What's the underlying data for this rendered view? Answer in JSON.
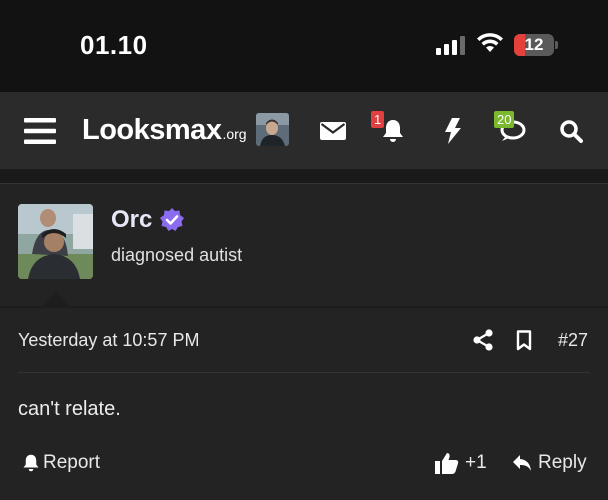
{
  "status_bar": {
    "time": "01.10",
    "battery_level": "12",
    "battery_color": "#e5413a",
    "icons": [
      "signal-icon",
      "wifi-icon",
      "battery-icon"
    ]
  },
  "navbar": {
    "logo_main": "Looksmax",
    "logo_tld": ".org",
    "notifications_count": "1",
    "conversations_count": "20",
    "icons": [
      "menu-icon",
      "avatar",
      "envelope-icon",
      "bell-icon",
      "bolt-icon",
      "chat-icon",
      "search-icon"
    ],
    "badge_colors": {
      "alerts": "#e04040",
      "conversations": "#7ab82d"
    }
  },
  "post": {
    "author": {
      "username": "Orc",
      "title": "diagnosed autist",
      "verified_color": "#8b6cf0"
    },
    "timestamp": "Yesterday at 10:57 PM",
    "post_number": "#27",
    "message": "can't relate.",
    "actions": {
      "report": "Report",
      "like": "+1",
      "reply": "Reply"
    }
  }
}
